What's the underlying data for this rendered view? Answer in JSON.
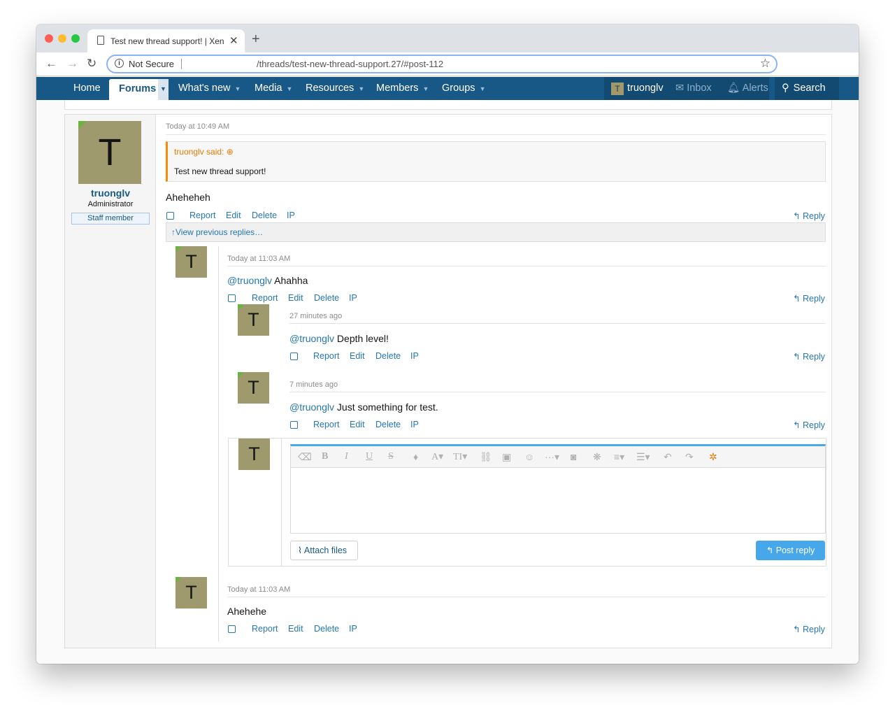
{
  "browser": {
    "tab_title": "Test new thread support! | XenForo",
    "new_tab_symbol": "+",
    "security_label": "Not Secure",
    "url": "/threads/test-new-thread-support.27/#post-112"
  },
  "site_nav": {
    "home": "Home",
    "forums": "Forums",
    "whats_new": "What's new",
    "media": "Media",
    "resources": "Resources",
    "members": "Members",
    "groups": "Groups",
    "account_initial": "T",
    "account_name": "truonglv",
    "inbox": "Inbox",
    "alerts": "Alerts",
    "search": "Search"
  },
  "post": {
    "user": {
      "initial": "T",
      "name": "truonglv",
      "title": "Administrator",
      "badge": "Staff member"
    },
    "time": "Today at 10:49 AM",
    "quote": {
      "author": "truonglv said:",
      "text": "Test new thread support!"
    },
    "message": "Aheheheh",
    "view_previous": "View previous replies…"
  },
  "actions": {
    "report": "Report",
    "edit": "Edit",
    "delete": "Delete",
    "ip": "IP",
    "reply": "Reply"
  },
  "replies": [
    {
      "initial": "T",
      "time": "Today at 11:03 AM",
      "mention": "@truonglv",
      "text": "Ahahha"
    },
    {
      "initial": "T",
      "time": "27 minutes ago",
      "mention": "@truonglv",
      "text": "Depth level!"
    },
    {
      "initial": "T",
      "time": "7 minutes ago",
      "mention": "@truonglv",
      "text": "Just something for test."
    },
    {
      "initial": "T",
      "time": "Today at 11:03 AM",
      "mention": "",
      "text": "Ahehehe"
    }
  ],
  "editor": {
    "avatar_initial": "T",
    "attach_label": "Attach files",
    "post_reply_label": "Post reply"
  },
  "colors": {
    "nav_bg": "#185886",
    "link": "#2577b1",
    "quote_accent": "#f78c07",
    "avatar_bg": "#9e9a6d",
    "online_indicator": "#6db33f",
    "primary_button": "#47a7eb"
  }
}
